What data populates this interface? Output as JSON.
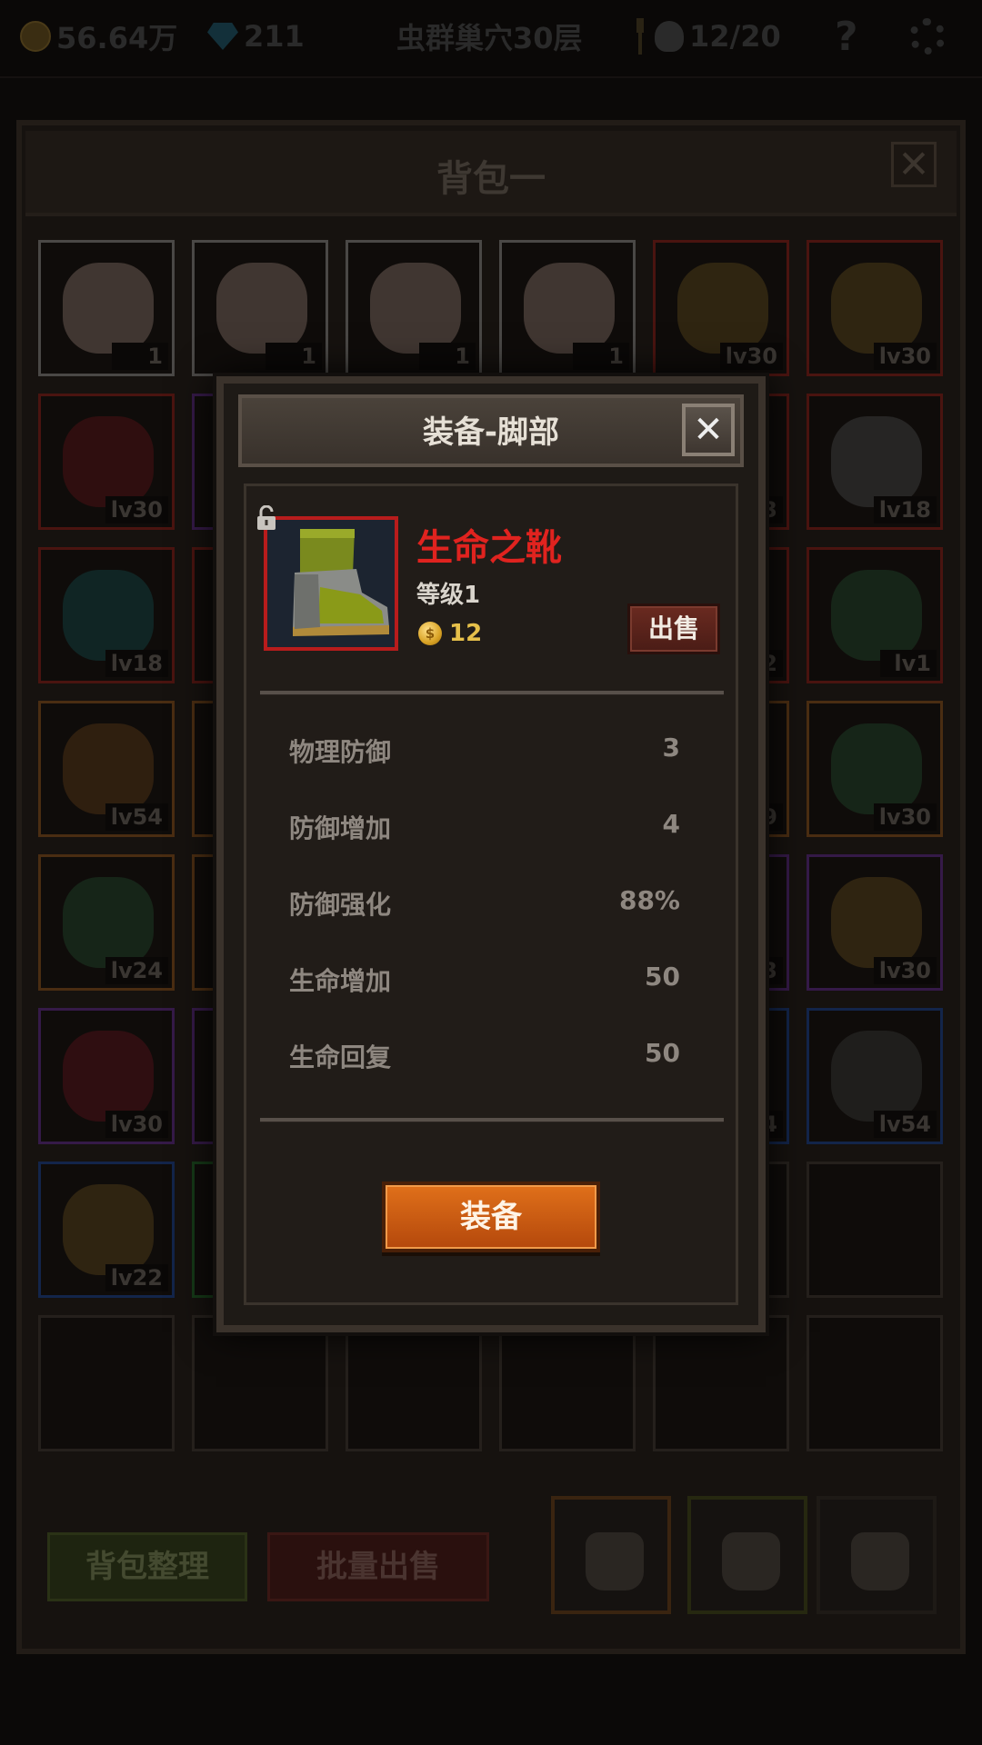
{
  "topbar": {
    "gold": "56.64万",
    "gems": "211",
    "location": "虫群巢穴30层",
    "kills": "12/20"
  },
  "bag": {
    "title": "背包一",
    "close_symbol": "✕",
    "slots": [
      {
        "label": "1",
        "quality": "white",
        "icon": "cake-icon"
      },
      {
        "label": "1",
        "quality": "white",
        "icon": "cake-icon"
      },
      {
        "label": "1",
        "quality": "white",
        "icon": "cake-icon"
      },
      {
        "label": "1",
        "quality": "white",
        "icon": "cake-icon"
      },
      {
        "label": "lv30",
        "quality": "red",
        "icon": "bow-icon"
      },
      {
        "label": "lv30",
        "quality": "red",
        "icon": "bow-icon"
      },
      {
        "label": "lv30",
        "quality": "red",
        "icon": "amulet-icon"
      },
      {
        "label": "",
        "quality": "purple",
        "icon": "unknown-icon"
      },
      {
        "label": "",
        "quality": "red",
        "icon": "unknown-icon"
      },
      {
        "label": "",
        "quality": "red",
        "icon": "unknown-icon"
      },
      {
        "label": "3",
        "quality": "red",
        "icon": "unknown-icon"
      },
      {
        "label": "lv18",
        "quality": "red",
        "icon": "dagger-icon"
      },
      {
        "label": "lv18",
        "quality": "red",
        "icon": "necklace-icon"
      },
      {
        "label": "",
        "quality": "red",
        "icon": "unknown-icon"
      },
      {
        "label": "",
        "quality": "red",
        "icon": "unknown-icon"
      },
      {
        "label": "",
        "quality": "red",
        "icon": "unknown-icon"
      },
      {
        "label": "2",
        "quality": "red",
        "icon": "unknown-icon"
      },
      {
        "label": "lv1",
        "quality": "red",
        "icon": "ring-icon"
      },
      {
        "label": "lv54",
        "quality": "orange",
        "icon": "bracer-icon"
      },
      {
        "label": "",
        "quality": "orange",
        "icon": "unknown-icon"
      },
      {
        "label": "",
        "quality": "orange",
        "icon": "unknown-icon"
      },
      {
        "label": "",
        "quality": "orange",
        "icon": "unknown-icon"
      },
      {
        "label": "9",
        "quality": "orange",
        "icon": "unknown-icon"
      },
      {
        "label": "lv30",
        "quality": "orange",
        "icon": "ring-icon"
      },
      {
        "label": "lv24",
        "quality": "orange",
        "icon": "ring-icon"
      },
      {
        "label": "",
        "quality": "orange",
        "icon": "unknown-icon"
      },
      {
        "label": "",
        "quality": "purple",
        "icon": "unknown-icon"
      },
      {
        "label": "",
        "quality": "purple",
        "icon": "unknown-icon"
      },
      {
        "label": "3",
        "quality": "purple",
        "icon": "unknown-icon"
      },
      {
        "label": "lv30",
        "quality": "purple",
        "icon": "pendant-icon"
      },
      {
        "label": "lv30",
        "quality": "purple",
        "icon": "armor-icon"
      },
      {
        "label": "",
        "quality": "purple",
        "icon": "unknown-icon"
      },
      {
        "label": "",
        "quality": "blue",
        "icon": "unknown-icon"
      },
      {
        "label": "",
        "quality": "blue",
        "icon": "unknown-icon"
      },
      {
        "label": "4",
        "quality": "blue",
        "icon": "unknown-icon"
      },
      {
        "label": "lv54",
        "quality": "blue",
        "icon": "shoulder-icon"
      },
      {
        "label": "lv22",
        "quality": "blue",
        "icon": "pendant-icon"
      },
      {
        "label": "",
        "quality": "green",
        "icon": "unknown-icon"
      },
      {
        "label": "",
        "quality": "none",
        "icon": ""
      },
      {
        "label": "",
        "quality": "none",
        "icon": ""
      },
      {
        "label": "",
        "quality": "none",
        "icon": ""
      },
      {
        "label": "",
        "quality": "none",
        "icon": ""
      },
      {
        "label": "",
        "quality": "none",
        "icon": ""
      },
      {
        "label": "",
        "quality": "none",
        "icon": ""
      },
      {
        "label": "",
        "quality": "none",
        "icon": ""
      },
      {
        "label": "",
        "quality": "none",
        "icon": ""
      },
      {
        "label": "",
        "quality": "none",
        "icon": ""
      },
      {
        "label": "",
        "quality": "none",
        "icon": ""
      }
    ],
    "sort_button": "背包整理",
    "batch_sell_button": "批量出售"
  },
  "popup": {
    "title": "装备-脚部",
    "close_symbol": "✕",
    "item": {
      "name": "生命之靴",
      "level": "等级1",
      "price": "12",
      "icon": "boot-icon",
      "locked": true
    },
    "sell_button": "出售",
    "stats": [
      {
        "name": "物理防御",
        "value": "3"
      },
      {
        "name": "防御增加",
        "value": "4"
      },
      {
        "name": "防御强化",
        "value": "88%"
      },
      {
        "name": "生命增加",
        "value": "50"
      },
      {
        "name": "生命回复",
        "value": "50"
      }
    ],
    "equip_button": "装备"
  },
  "colors": {
    "item_name_red": "#e0231f",
    "price_gold": "#e6c04a",
    "equip_orange": "#d0600f",
    "sell_dark_red": "#5a2219"
  }
}
